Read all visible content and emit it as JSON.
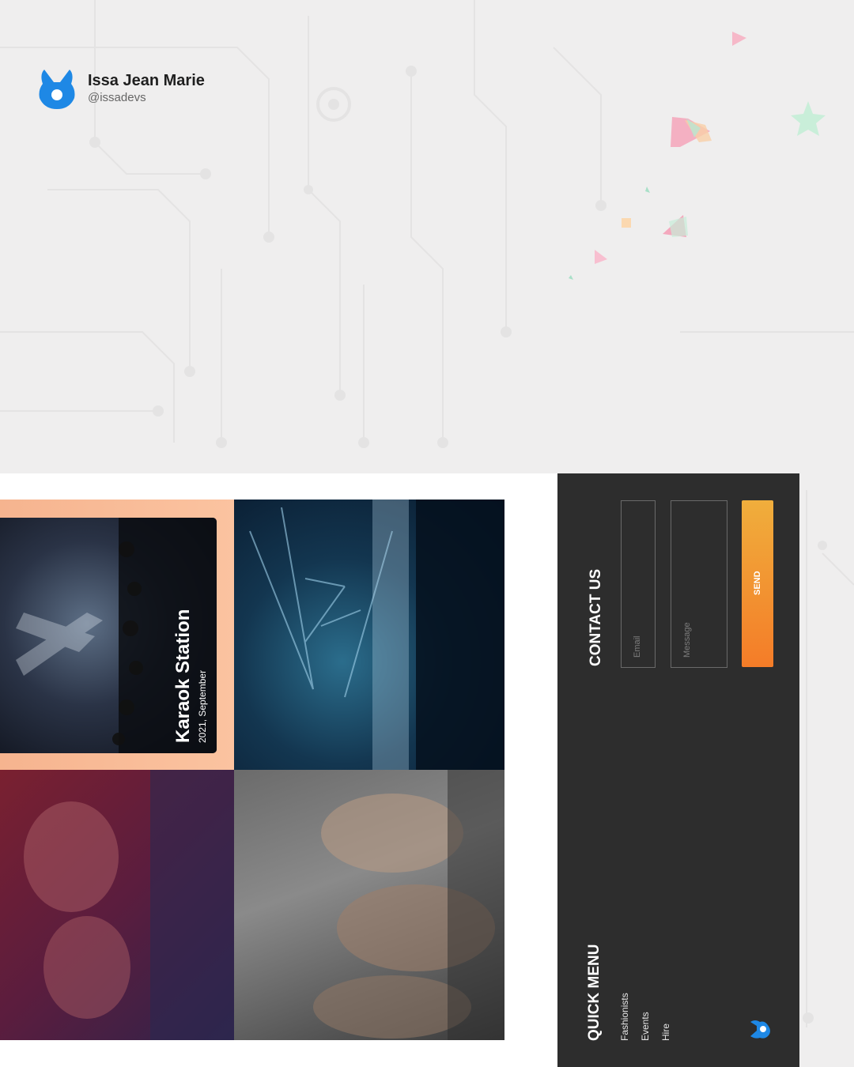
{
  "profile": {
    "name": "Issa Jean Marie",
    "handle": "@issadevs"
  },
  "featured_event": {
    "title": "Karaok Station",
    "date": "2021, September"
  },
  "contact": {
    "heading": "CONTACT US",
    "email_placeholder": "Email",
    "message_placeholder": "Message",
    "send_label": "SEND"
  },
  "quick_menu": {
    "heading": "QUICK MENU",
    "items": [
      {
        "label": "Fashionists"
      },
      {
        "label": "Events"
      },
      {
        "label": "Hire"
      }
    ]
  },
  "colors": {
    "accent_start": "#f0ae3c",
    "accent_end": "#f47c28",
    "brand_blue": "#1e88e5",
    "dark_panel": "#2d2d2d"
  },
  "icons": {
    "brand": "bunny-logo-icon"
  }
}
